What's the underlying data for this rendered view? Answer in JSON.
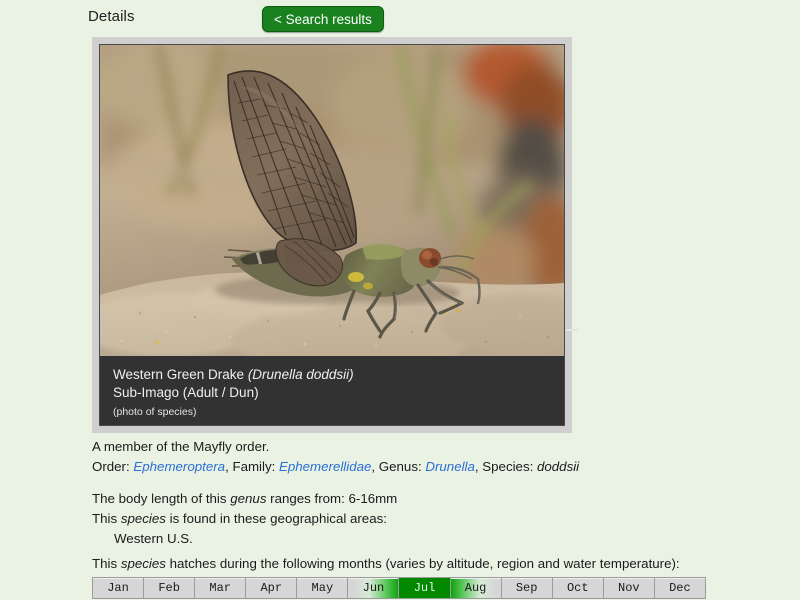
{
  "header": {
    "title": "Details",
    "back_button": "< Search results"
  },
  "photo": {
    "alt_name": "mayfly-sub-imago-photo",
    "caption_common_name": "Western Green Drake ",
    "caption_scientific_name": "(Drunella doddsii)",
    "caption_stage": "Sub-Imago (Adult / Dun)",
    "caption_note": "(photo of species)"
  },
  "details": {
    "order_note": "A member of the Mayfly order.",
    "taxonomy": {
      "order_label": "Order: ",
      "order_value": "Ephemeroptera",
      "family_label": ", Family: ",
      "family_value": "Ephemerellidae",
      "genus_label": ", Genus: ",
      "genus_value": "Drunella",
      "species_label": ", Species: ",
      "species_value": "doddsii"
    },
    "body_length_pre": "The body length of this ",
    "body_length_em": "genus",
    "body_length_post": " ranges from: 6-16mm",
    "geo_pre": "This ",
    "geo_em": "species",
    "geo_post": " is found in these geographical areas:",
    "geo_area": "Western U.S."
  },
  "hatch": {
    "label_pre": "This ",
    "label_em": "species",
    "label_post": " hatches during the following months (varies by altitude, region and water temperature):",
    "months": [
      {
        "label": "Jan",
        "state": "none"
      },
      {
        "label": "Feb",
        "state": "none"
      },
      {
        "label": "Mar",
        "state": "none"
      },
      {
        "label": "Apr",
        "state": "none"
      },
      {
        "label": "May",
        "state": "none"
      },
      {
        "label": "Jun",
        "state": "partial-start"
      },
      {
        "label": "Jul",
        "state": "full"
      },
      {
        "label": "Aug",
        "state": "partial-end"
      },
      {
        "label": "Sep",
        "state": "none"
      },
      {
        "label": "Oct",
        "state": "none"
      },
      {
        "label": "Nov",
        "state": "none"
      },
      {
        "label": "Dec",
        "state": "none"
      }
    ]
  },
  "colors": {
    "page_background": "#e9f2e3",
    "button_green": "#19821f",
    "hatch_green": "#018a01",
    "link_blue": "#2b6fd6",
    "caption_background": "#323232",
    "frame_gray": "#cfcfcf"
  }
}
